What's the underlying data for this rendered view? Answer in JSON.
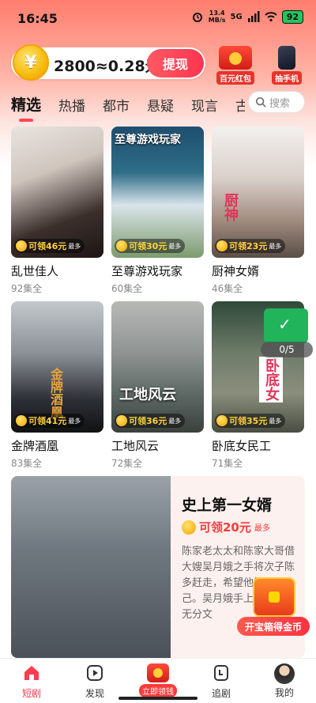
{
  "status_bar": {
    "time": "16:45",
    "net_speed": "13.4",
    "net_unit": "MB/s",
    "signal": "5G",
    "battery": "92"
  },
  "header": {
    "coin_text": "2800≈0.28元",
    "withdraw_label": "提现",
    "coin_symbol": "¥",
    "promo_redpacket_label": "百元红包",
    "promo_phone_label": "抽手机"
  },
  "tabs": [
    "精选",
    "热播",
    "都市",
    "悬疑",
    "现言",
    "古"
  ],
  "search": {
    "placeholder": "搜索"
  },
  "cards": [
    {
      "title": "乱世佳人",
      "eps": "92集全",
      "reward": "可领46元",
      "most": "最多"
    },
    {
      "title": "至尊游戏玩家",
      "eps": "60集全",
      "reward": "可领30元",
      "most": "最多",
      "overlay": "至尊游戏玩家"
    },
    {
      "title": "厨神女婿",
      "eps": "46集全",
      "reward": "可领23元",
      "most": "最多",
      "overlay": "厨神"
    },
    {
      "title": "金牌酒凰",
      "eps": "83集全",
      "reward": "可领41元",
      "most": "最多",
      "overlay": "金牌酒凰"
    },
    {
      "title": "工地风云",
      "eps": "72集全",
      "reward": "可领36元",
      "most": "最多",
      "overlay": "工地风云"
    },
    {
      "title": "卧底女民工",
      "eps": "71集全",
      "reward": "可领35元",
      "most": "最多",
      "overlay": "卧底女"
    }
  ],
  "episode_badge": "0/5",
  "featured": {
    "title": "史上第一女婿",
    "reward": "可领20元",
    "most": "最多",
    "desc": "陈家老太太和陈家大哥借大嫂吴月娥之手将次子陈多赶走，希望他能磨练自己。吴月娥手上，家。身无分文"
  },
  "treasure_button": "开宝箱得金币",
  "bottom_nav": [
    {
      "label": "短剧"
    },
    {
      "label": "发现"
    },
    {
      "label": "立即领钱"
    },
    {
      "label": "追剧"
    },
    {
      "label": "我的"
    }
  ],
  "colors": {
    "accent": "#ff3b4d",
    "coin": "#f5b400",
    "reward_text": "#ff3b3b"
  }
}
